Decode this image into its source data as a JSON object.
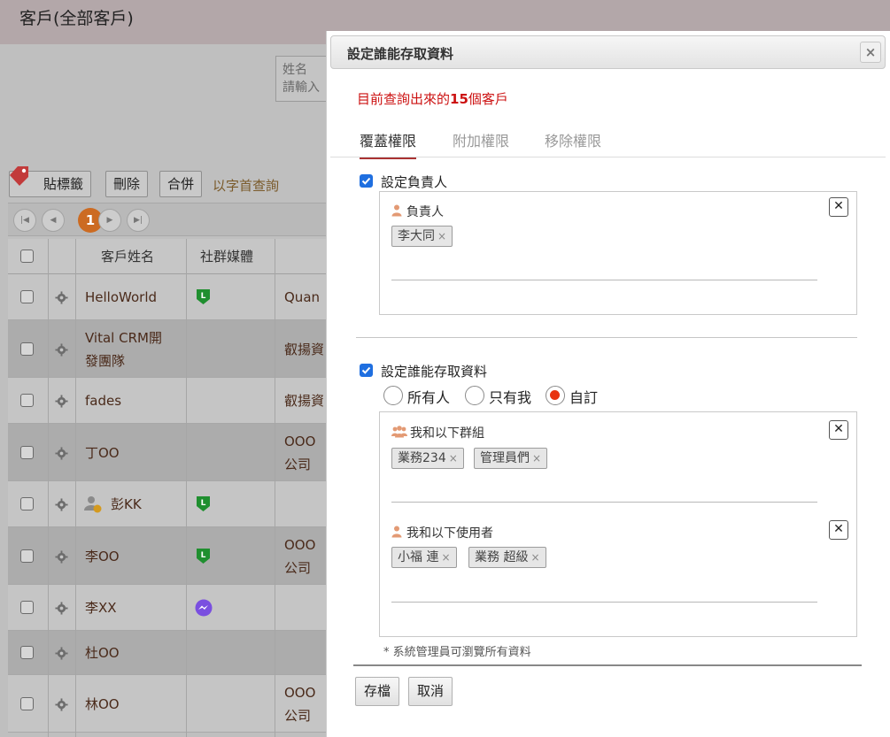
{
  "page": {
    "title": "客戶(全部客戶)"
  },
  "search": {
    "label": "姓名",
    "placeholder": "請輸入"
  },
  "toolbar": {
    "tag_label": "貼標籤",
    "delete_label": "刪除",
    "merge_label": "合併",
    "alpha_query_label": "以字首查詢"
  },
  "pager": {
    "current_page": "1"
  },
  "grid": {
    "headers": {
      "name": "客戶姓名",
      "social": "社群媒體"
    },
    "rows": [
      {
        "name": "HelloWorld",
        "social": "line",
        "company": "Quan"
      },
      {
        "name": "Vital CRM開\n發團隊",
        "social": "",
        "company": "叡揚資"
      },
      {
        "name": "fades",
        "social": "",
        "company": "叡揚資"
      },
      {
        "name": "丁OO",
        "social": "",
        "company": "OOO\n公司"
      },
      {
        "name": "彭KK",
        "social": "line",
        "company": ""
      },
      {
        "name": "李OO",
        "social": "line",
        "company": "OOO\n公司"
      },
      {
        "name": "李XX",
        "social": "messenger",
        "company": ""
      },
      {
        "name": "杜OO",
        "social": "",
        "company": ""
      },
      {
        "name": "林OO",
        "social": "",
        "company": "OOO\n公司"
      }
    ]
  },
  "modal": {
    "title": "設定誰能存取資料",
    "close_label": "×",
    "query_prefix": "目前查詢出來的",
    "query_count": "15",
    "query_suffix": "個客戶",
    "tabs": [
      "覆蓋權限",
      "附加權限",
      "移除權限"
    ],
    "owner_section": {
      "checkbox_label": "設定負責人",
      "panel_label": "負責人",
      "chips": [
        "李大同"
      ]
    },
    "access_section": {
      "checkbox_label": "設定誰能存取資料",
      "radio_options": [
        "所有人",
        "只有我",
        "自訂"
      ],
      "selected": "自訂",
      "groups_label": "我和以下群組",
      "groups": [
        "業務234",
        "管理員們"
      ],
      "users_label": "我和以下使用者",
      "users": [
        "小福 連",
        "業務 超級"
      ]
    },
    "note": "*  系統管理員可瀏覽所有資料",
    "save_label": "存檔",
    "cancel_label": "取消"
  },
  "colors": {
    "accent_red": "#cc1111",
    "checkbox_blue": "#1f6fe0",
    "radio_red": "#e8330f",
    "pager_orange": "#cc6b22"
  }
}
